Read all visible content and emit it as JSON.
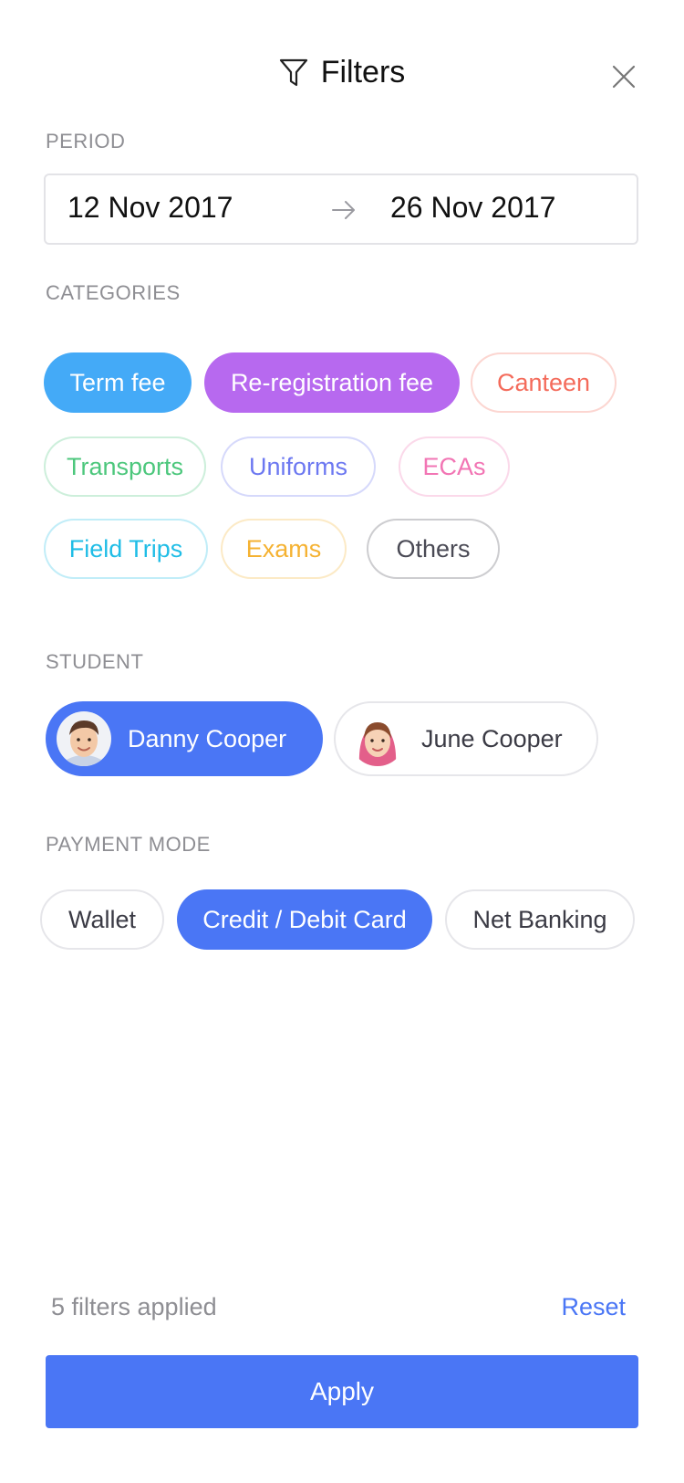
{
  "header": {
    "title": "Filters",
    "filter_icon": "funnel-icon",
    "close_icon": "close-icon"
  },
  "period": {
    "label": "PERIOD",
    "from": "12 Nov 2017",
    "to": "26 Nov 2017",
    "arrow_icon": "arrow-right-icon"
  },
  "categories": {
    "label": "CATEGORIES",
    "items": [
      {
        "label": "Term fee",
        "selected": true,
        "color": "#44aaf7"
      },
      {
        "label": "Re-registration fee",
        "selected": true,
        "color": "#b769ef"
      },
      {
        "label": "Canteen",
        "selected": false,
        "color": "#f46b5b"
      },
      {
        "label": "Transports",
        "selected": false,
        "color": "#4cc77c"
      },
      {
        "label": "Uniforms",
        "selected": false,
        "color": "#6c78f1"
      },
      {
        "label": "ECAs",
        "selected": false,
        "color": "#f275b4"
      },
      {
        "label": "Field Trips",
        "selected": false,
        "color": "#1fbde6"
      },
      {
        "label": "Exams",
        "selected": false,
        "color": "#f5b232"
      },
      {
        "label": "Others",
        "selected": false,
        "color": "#4a4a55"
      }
    ]
  },
  "student": {
    "label": "STUDENT",
    "items": [
      {
        "name": "Danny Cooper",
        "selected": true
      },
      {
        "name": "June Cooper",
        "selected": false
      }
    ]
  },
  "payment_mode": {
    "label": "PAYMENT MODE",
    "items": [
      {
        "label": "Wallet",
        "selected": false
      },
      {
        "label": "Credit / Debit Card",
        "selected": true
      },
      {
        "label": "Net Banking",
        "selected": false
      }
    ]
  },
  "footer": {
    "status": "5 filters applied",
    "reset_label": "Reset",
    "apply_label": "Apply"
  },
  "colors": {
    "accent": "#4a76f5",
    "muted_text": "#8e8e93",
    "border": "#e6e6ea"
  }
}
